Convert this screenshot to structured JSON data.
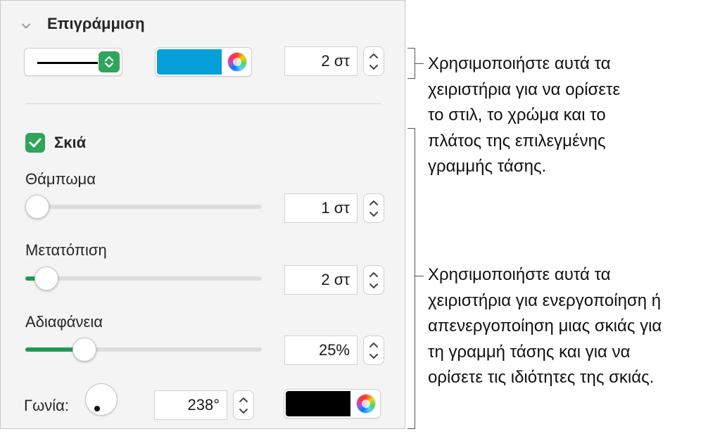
{
  "stroke": {
    "title": "Επιγράμμιση",
    "width_value": "2 στ",
    "color": "#069fd9"
  },
  "shadow": {
    "title": "Σκιά",
    "enabled": true,
    "blur": {
      "label": "Θάμπωμα",
      "value": "1 στ",
      "level": 0.05
    },
    "offset": {
      "label": "Μετατόπιση",
      "value": "2 στ",
      "level": 0.09
    },
    "opacity": {
      "label": "Αδιαφάνεια",
      "value": "25%",
      "level": 0.25
    },
    "angle": {
      "label": "Γωνία:",
      "value": "238°",
      "degrees": 238
    },
    "color": "#000000"
  },
  "accent_color": "#2fa55a",
  "callouts": {
    "top": [
      "Χρησιμοποιήστε αυτά τα",
      "χειριστήρια για να ορίσετε",
      "το στιλ, το χρώμα και το",
      "πλάτος της επιλεγμένης",
      "γραμμής τάσης."
    ],
    "bottom": [
      "Χρησιμοποιήστε αυτά τα",
      "χειριστήρια για ενεργοποίηση ή",
      "απενεργοποίηση μιας σκιάς για",
      "τη γραμμή τάσης και για να",
      "ορίσετε τις ιδιότητες της σκιάς."
    ]
  }
}
